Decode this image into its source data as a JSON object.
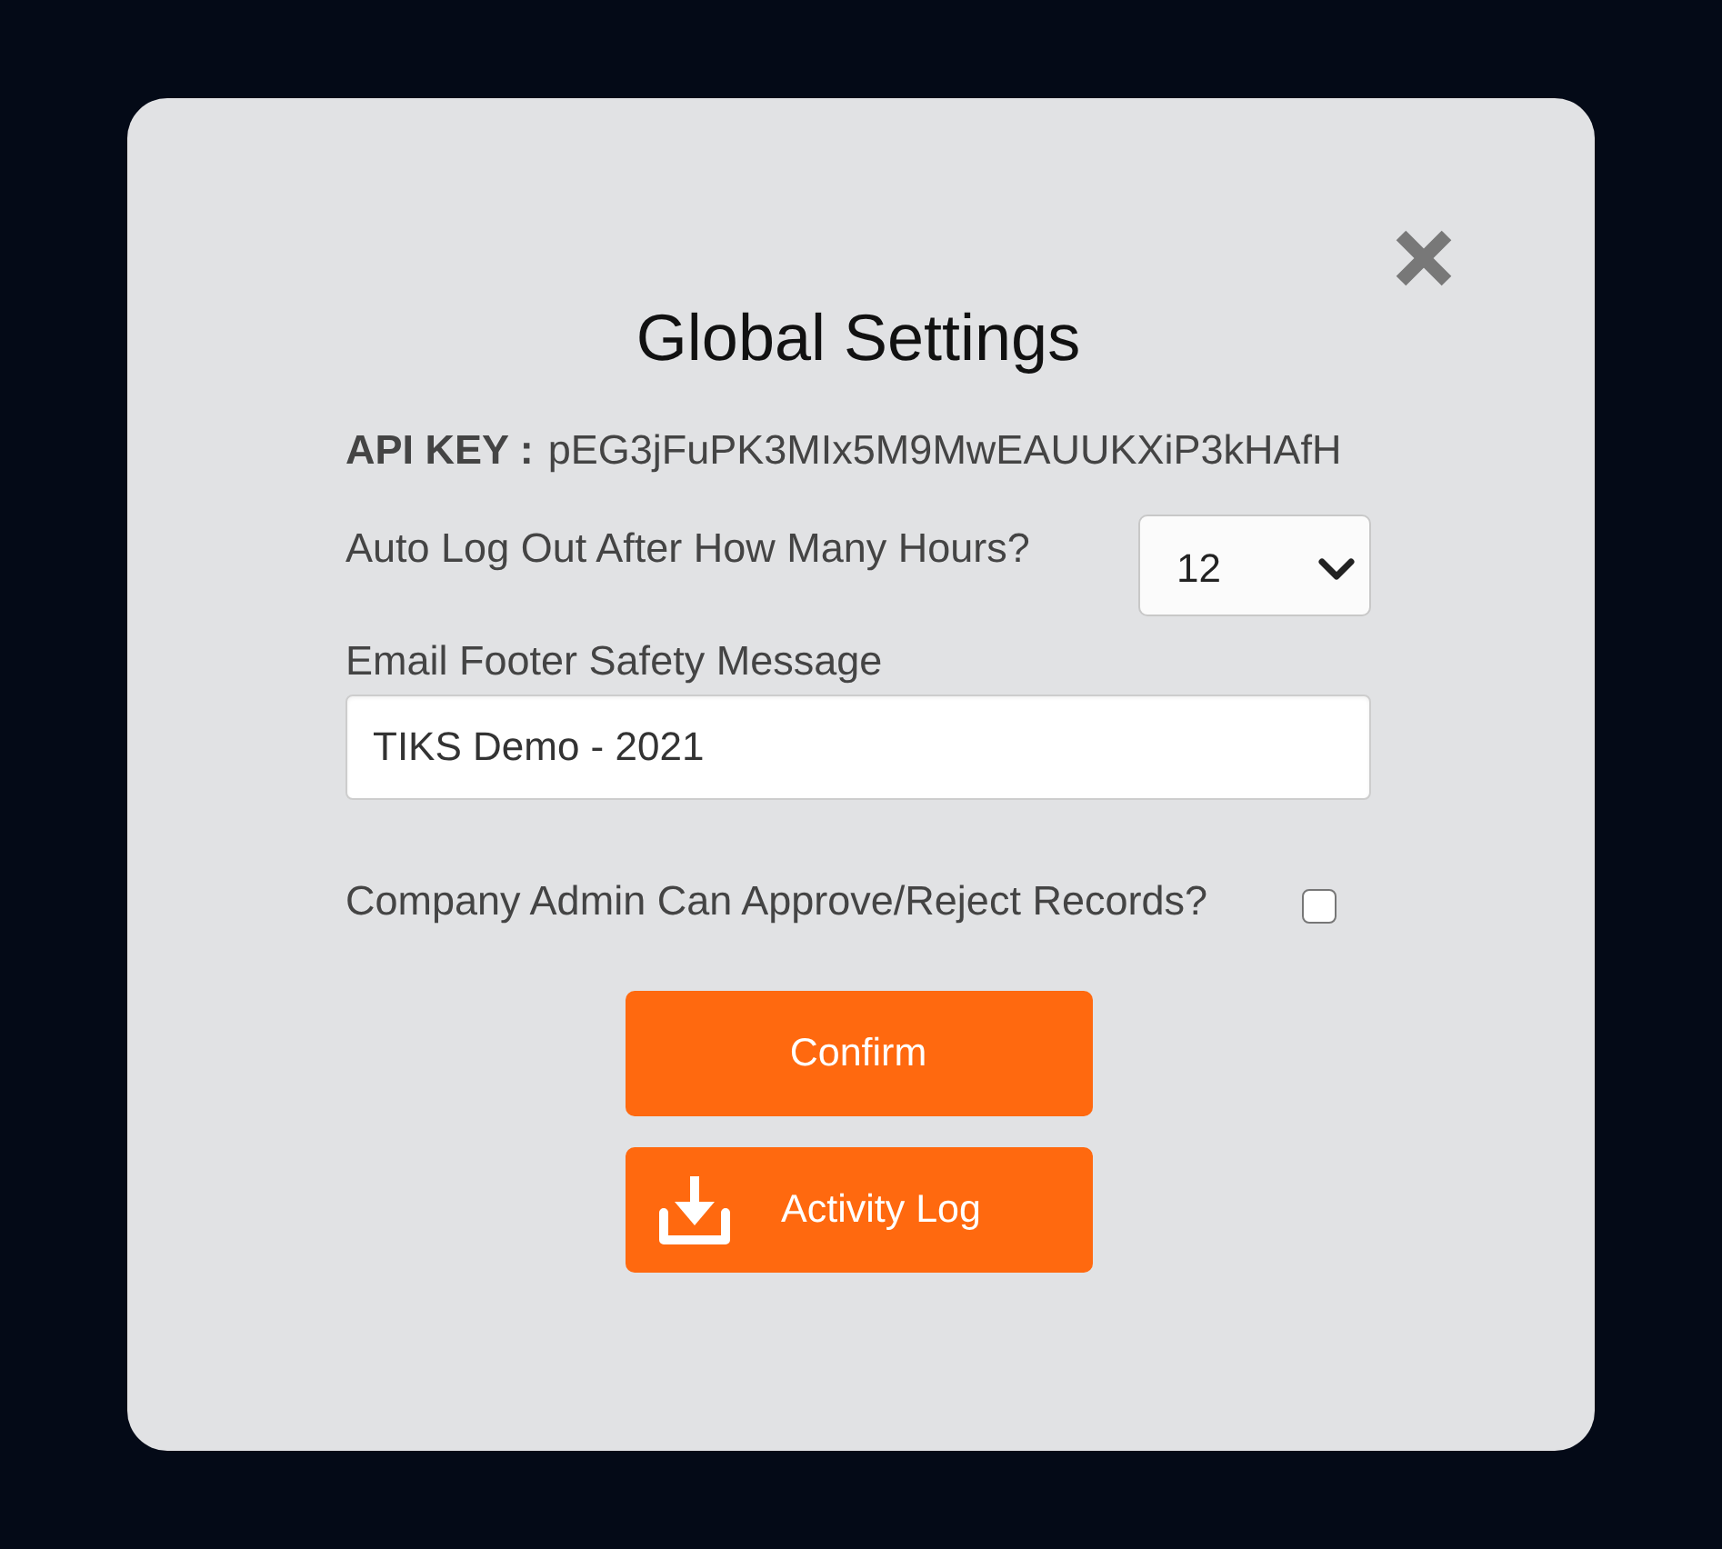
{
  "dialog": {
    "title": "Global Settings",
    "api_key": {
      "label": "API KEY :",
      "value": "pEG3jFuPK3MIx5M9MwEAUUKXiP3kHAfH"
    },
    "auto_logout": {
      "label": "Auto Log Out After How Many Hours?",
      "value": "12"
    },
    "footer_message": {
      "label": "Email Footer Safety Message",
      "value": "TIKS Demo - 2021"
    },
    "admin_approval": {
      "label": "Company Admin Can Approve/Reject Records?",
      "checked": false
    },
    "buttons": [
      {
        "label": "Confirm",
        "kind": "confirm"
      },
      {
        "label": "Activity Log",
        "kind": "download"
      }
    ]
  }
}
